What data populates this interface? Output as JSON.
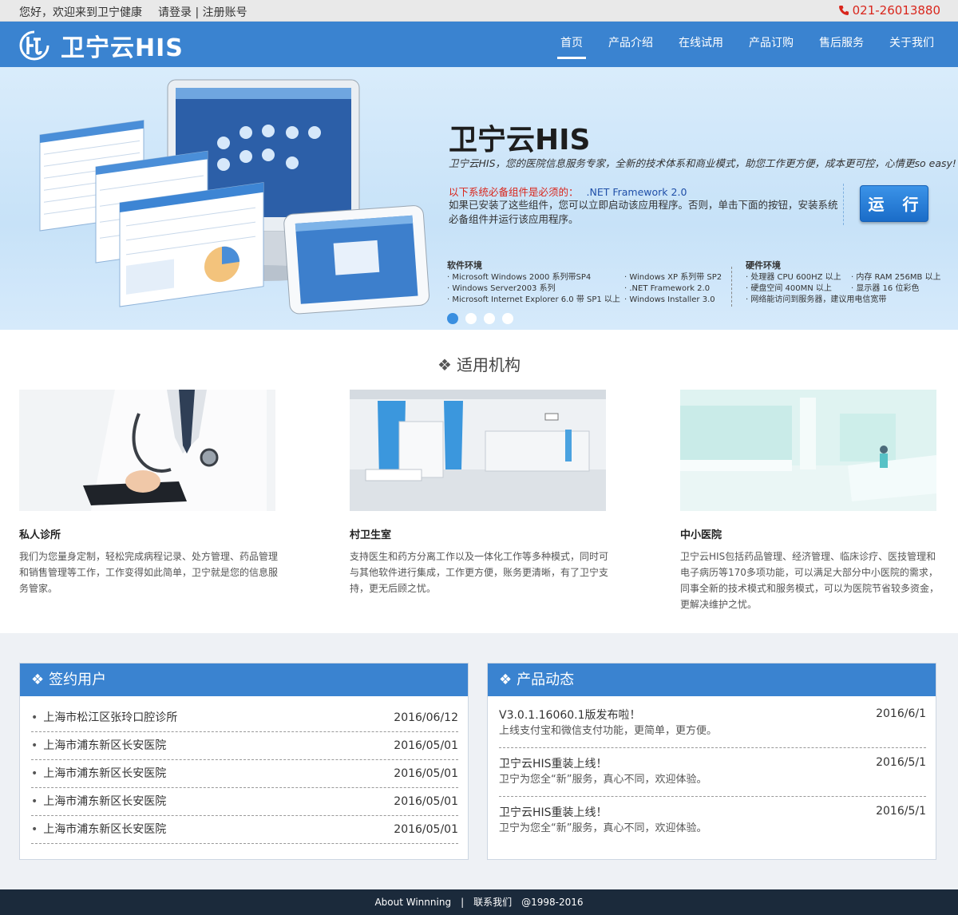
{
  "topbar": {
    "welcome": "您好，欢迎来到卫宁健康",
    "login": "请登录",
    "divider": "|",
    "register": "注册账号",
    "phone": "021-26013880"
  },
  "header": {
    "logo_text": "卫宁云HIS",
    "nav": [
      "首页",
      "产品介绍",
      "在线试用",
      "产品订购",
      "售后服务",
      "关于我们"
    ],
    "active_nav": "首页"
  },
  "banner": {
    "title": "卫宁云HIS",
    "subtitle": "卫宁云HIS，您的医院信息服务专家，全新的技术体系和商业模式，助您工作更方便，成本更可控，心情更so easy!",
    "required_label": "以下系统必备组件是必须的：",
    "required_component": ".NET Framework 2.0",
    "description": "如果已安装了这些组件，您可以立即启动该应用程序。否则，单击下面的按钮，安装系统必备组件并运行该应用程序。",
    "run_button": "运 行",
    "software_title": "软件环境",
    "software_col1": [
      "· Microsoft Windows 2000 系列带SP4",
      "· Windows Server2003 系列",
      "· Microsoft Internet Explorer 6.0 带 SP1 以上"
    ],
    "software_col2": [
      "· Windows XP 系列带 SP2",
      "· .NET Framework 2.0",
      "· Windows Installer 3.0"
    ],
    "hardware_title": "硬件环境",
    "hardware_col1": [
      "· 处理器 CPU 600HZ 以上",
      "· 硬盘空间 400MN 以上",
      "· 网络能访问到服务器，建议用电信宽带"
    ],
    "hardware_col2": [
      "· 内存 RAM 256MB 以上",
      "· 显示器 16 位彩色"
    ],
    "slides": 4,
    "active_slide": 1
  },
  "institutions": {
    "title": "适用机构",
    "cards": [
      {
        "name": "私人诊所",
        "desc": "我们为您量身定制，轻松完成病程记录、处方管理、药品管理和销售管理等工作，工作变得如此简单，卫宁就是您的信息服务管家。"
      },
      {
        "name": "村卫生室",
        "desc": "支持医生和药方分离工作以及一体化工作等多种模式，同时可与其他软件进行集成，工作更方便，账务更清晰，有了卫宁支持，更无后顾之忧。"
      },
      {
        "name": "中小医院",
        "desc": "卫宁云HIS包括药品管理、经济管理、临床诊疗、医技管理和电子病历等170多项功能，可以满足大部分中小医院的需求，同事全新的技术模式和服务模式，可以为医院节省较多资金，更解决维护之忧。"
      }
    ]
  },
  "signed": {
    "title": "签约用户",
    "rows": [
      {
        "name": "上海市松江区张玲口腔诊所",
        "date": "2016/06/12"
      },
      {
        "name": "上海市浦东新区长安医院",
        "date": "2016/05/01"
      },
      {
        "name": "上海市浦东新区长安医院",
        "date": "2016/05/01"
      },
      {
        "name": "上海市浦东新区长安医院",
        "date": "2016/05/01"
      },
      {
        "name": "上海市浦东新区长安医院",
        "date": "2016/05/01"
      }
    ]
  },
  "news": {
    "title": "产品动态",
    "items": [
      {
        "title": "V3.0.1.16060.1版发布啦！",
        "summary": "上线支付宝和微信支付功能，更简单，更方便。",
        "date": "2016/6/1"
      },
      {
        "title": "卫宁云HIS重装上线！",
        "summary": "卫宁为您全“新”服务，真心不同，欢迎体验。",
        "date": "2016/5/1"
      },
      {
        "title": "卫宁云HIS重装上线！",
        "summary": "卫宁为您全“新”服务，真心不同，欢迎体验。",
        "date": "2016/5/1"
      }
    ]
  },
  "footer": {
    "about": "About Winnning",
    "sep": "|",
    "contact": "联系我们",
    "copyright": "@1998-2016"
  },
  "colors": {
    "brand_blue": "#3a83d0",
    "phone_red": "#d9261c",
    "footer_bg": "#1b2a3b"
  }
}
